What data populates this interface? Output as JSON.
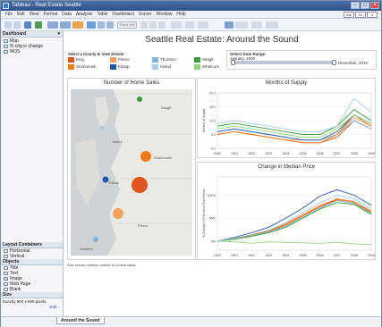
{
  "window": {
    "title": "Tableau - Real Estate Seattle"
  },
  "menu": [
    "File",
    "Edit",
    "View",
    "Format",
    "Data",
    "Analysis",
    "Table",
    "Dashboard",
    "Server",
    "Window",
    "Help"
  ],
  "tab_switch": [
    "xxx",
    "xx",
    "x"
  ],
  "toolbar": {
    "show_me_label": "Show Me!"
  },
  "dashboard_panel": {
    "header": "Dashboard",
    "items": [
      {
        "label": "Map"
      },
      {
        "label": "% chg in change"
      },
      {
        "label": "MOS"
      }
    ]
  },
  "layout_panel": {
    "header": "Layout Containers",
    "items": [
      {
        "label": "Horizontal"
      },
      {
        "label": "Vertical"
      }
    ]
  },
  "objects_panel": {
    "header": "Objects",
    "items": [
      {
        "label": "Title"
      },
      {
        "label": "Text"
      },
      {
        "label": "Image"
      },
      {
        "label": "Web Page"
      },
      {
        "label": "Blank"
      }
    ]
  },
  "size_panel": {
    "header": "Size",
    "value": "Exactly 900 x 650 pixels",
    "edit_label": "Edit..."
  },
  "dashboard": {
    "title": "Seattle Real Estate: Around the Sound",
    "county_filter_label": "Select a County to View Details:",
    "counties": [
      {
        "name": "King",
        "color": "#e0561c"
      },
      {
        "name": "Pierce",
        "color": "#f4a261"
      },
      {
        "name": "Thurston",
        "color": "#7fb4dc"
      },
      {
        "name": "Skagit",
        "color": "#3c9c3c"
      },
      {
        "name": "Snohomish",
        "color": "#f07a16"
      },
      {
        "name": "Kitsap",
        "color": "#1f5aa6"
      },
      {
        "name": "Island",
        "color": "#a8cce6"
      },
      {
        "name": "Whatcom",
        "color": "#8fd37a"
      }
    ],
    "date_range": {
      "label": "Select Date Range:",
      "start": "January, 2000",
      "end": "December, 2010",
      "start_fraction": 0.0,
      "end_fraction": 1.0
    },
    "map": {
      "title": "Number of Home Sales",
      "caption": "Size shows relative number of closed sales.",
      "labels": [
        "Skagit",
        "Island",
        "Snohomish",
        "Kitsap",
        "Pierce",
        "Thurston"
      ]
    }
  },
  "chart_data": [
    {
      "type": "line",
      "title": "Months of Supply",
      "xlabel": "",
      "ylabel": "Months of Supply",
      "x_ticks": [
        "2000",
        "2001",
        "2002",
        "2003",
        "2004",
        "2005",
        "2006",
        "2007",
        "2008",
        "2009"
      ],
      "y_ticks": [
        "0.0",
        "5.0",
        "10.0",
        "15.0",
        "20.0"
      ],
      "ylim": [
        0,
        20
      ],
      "x": [
        2000,
        2001,
        2002,
        2003,
        2004,
        2005,
        2006,
        2007,
        2008,
        2009
      ],
      "series": [
        {
          "name": "King",
          "color": "#e0561c",
          "values": [
            5,
            6,
            5,
            4,
            3,
            2,
            2,
            4,
            10,
            7
          ]
        },
        {
          "name": "Pierce",
          "color": "#f4a261",
          "values": [
            5,
            6,
            5,
            4,
            3,
            3,
            3,
            5,
            11,
            8
          ]
        },
        {
          "name": "Thurston",
          "color": "#7fb4dc",
          "values": [
            6,
            7,
            6,
            5,
            4,
            3,
            3,
            5,
            10,
            7
          ]
        },
        {
          "name": "Skagit",
          "color": "#3c9c3c",
          "values": [
            8,
            9,
            8,
            7,
            6,
            5,
            5,
            8,
            14,
            10
          ]
        },
        {
          "name": "Snohomish",
          "color": "#f07a16",
          "values": [
            5,
            6,
            5,
            4,
            3,
            2,
            2,
            5,
            12,
            8
          ]
        },
        {
          "name": "Kitsap",
          "color": "#1f5aa6",
          "values": [
            6,
            7,
            6,
            5,
            4,
            3,
            3,
            6,
            12,
            9
          ]
        },
        {
          "name": "Island",
          "color": "#a8cce6",
          "values": [
            9,
            10,
            9,
            8,
            7,
            6,
            6,
            8,
            18,
            13
          ]
        },
        {
          "name": "Whatcom",
          "color": "#8fd37a",
          "values": [
            7,
            8,
            7,
            6,
            5,
            4,
            4,
            7,
            12,
            9
          ]
        }
      ]
    },
    {
      "type": "line",
      "title": "Change in Median Price",
      "xlabel": "",
      "ylabel": "% Change in Price from First Period",
      "x_ticks": [
        "2000",
        "2001",
        "2002",
        "2003",
        "2004",
        "2005",
        "2006",
        "2007",
        "2008",
        "2009"
      ],
      "y_ticks": [
        "0%",
        "50%",
        "100%"
      ],
      "ylim": [
        -20,
        140
      ],
      "x": [
        2000,
        2001,
        2002,
        2003,
        2004,
        2005,
        2006,
        2007,
        2008,
        2009
      ],
      "series": [
        {
          "name": "King",
          "color": "#e0561c",
          "values": [
            0,
            5,
            12,
            20,
            35,
            55,
            75,
            90,
            85,
            65
          ]
        },
        {
          "name": "Pierce",
          "color": "#f4a261",
          "values": [
            0,
            6,
            14,
            22,
            38,
            58,
            78,
            92,
            84,
            60
          ]
        },
        {
          "name": "Thurston",
          "color": "#7fb4dc",
          "values": [
            0,
            5,
            12,
            20,
            32,
            52,
            72,
            88,
            82,
            60
          ]
        },
        {
          "name": "Skagit",
          "color": "#3c9c3c",
          "values": [
            0,
            4,
            10,
            18,
            30,
            50,
            70,
            84,
            80,
            58
          ]
        },
        {
          "name": "Snohomish",
          "color": "#f07a16",
          "values": [
            0,
            6,
            13,
            22,
            36,
            56,
            76,
            92,
            86,
            62
          ]
        },
        {
          "name": "Kitsap",
          "color": "#1f5aa6",
          "values": [
            0,
            8,
            18,
            30,
            50,
            72,
            98,
            112,
            100,
            78
          ]
        },
        {
          "name": "Island",
          "color": "#a8cce6",
          "values": [
            0,
            6,
            14,
            24,
            40,
            62,
            84,
            100,
            92,
            70
          ]
        },
        {
          "name": "Whatcom",
          "color": "#8fd37a",
          "values": [
            0,
            -2,
            -5,
            -2,
            -3,
            -4,
            -5,
            -3,
            -6,
            -8
          ]
        }
      ]
    }
  ],
  "sheet_tab": {
    "label": "Around the Sound"
  }
}
